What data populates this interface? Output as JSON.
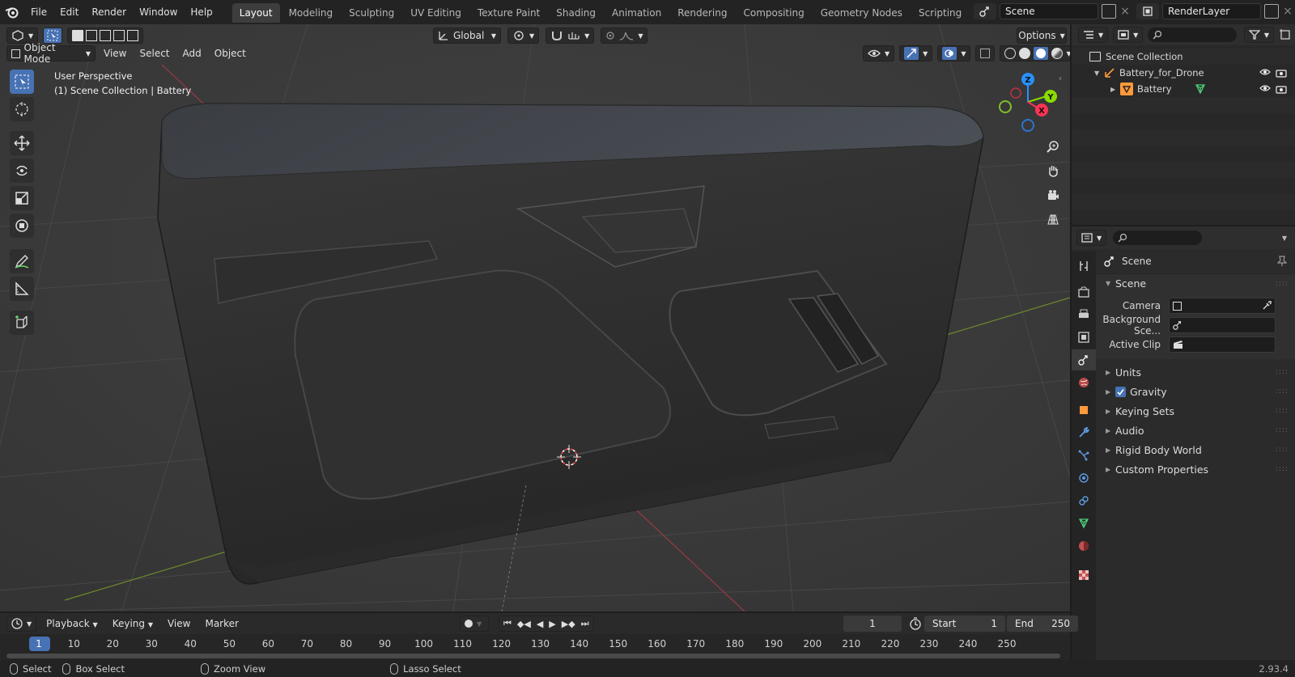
{
  "menu": {
    "items": [
      "File",
      "Edit",
      "Render",
      "Window",
      "Help"
    ]
  },
  "workspaces": {
    "tabs": [
      "Layout",
      "Modeling",
      "Sculpting",
      "UV Editing",
      "Texture Paint",
      "Shading",
      "Animation",
      "Rendering",
      "Compositing",
      "Geometry Nodes",
      "Scripting"
    ],
    "active": "Layout",
    "add_label": "+"
  },
  "scene_selector": {
    "value": "Scene"
  },
  "view_layer_selector": {
    "value": "RenderLayer"
  },
  "viewport": {
    "transform_orientation": "Global",
    "options_label": "Options",
    "mode": "Object Mode",
    "header_menus": [
      "View",
      "Select",
      "Add",
      "Object"
    ],
    "overlay_text": {
      "perspective": "User Perspective",
      "collection": "(1) Scene Collection | Battery"
    },
    "gizmo_axes": {
      "z": "Z",
      "y": "Y",
      "x": "X"
    }
  },
  "outliner": {
    "search_placeholder": "",
    "rows": [
      {
        "label": "Scene Collection"
      },
      {
        "label": "Battery_for_Drone"
      },
      {
        "label": "Battery"
      }
    ]
  },
  "properties": {
    "search_placeholder": "",
    "context_label": "Scene",
    "scene_panel": {
      "title": "Scene",
      "fields": [
        {
          "label": "Camera",
          "value": ""
        },
        {
          "label": "Background Sce...",
          "value": ""
        },
        {
          "label": "Active Clip",
          "value": ""
        }
      ]
    },
    "panels": [
      {
        "label": "Units",
        "checkbox": false
      },
      {
        "label": "Gravity",
        "checkbox": true
      },
      {
        "label": "Keying Sets",
        "checkbox": false
      },
      {
        "label": "Audio",
        "checkbox": false
      },
      {
        "label": "Rigid Body World",
        "checkbox": false
      },
      {
        "label": "Custom Properties",
        "checkbox": false
      }
    ]
  },
  "timeline": {
    "menus": [
      "Playback",
      "Keying",
      "View",
      "Marker"
    ],
    "current_frame": "1",
    "start_label": "Start",
    "start_value": "1",
    "end_label": "End",
    "end_value": "250",
    "ruler_labels": [
      "1",
      "10",
      "20",
      "30",
      "40",
      "50",
      "60",
      "70",
      "80",
      "90",
      "100",
      "110",
      "120",
      "130",
      "140",
      "150",
      "160",
      "170",
      "180",
      "190",
      "200",
      "210",
      "220",
      "230",
      "240",
      "250"
    ]
  },
  "statusbar": {
    "hints": [
      "Select",
      "Box Select",
      "Zoom View",
      "Lasso Select"
    ],
    "version": "2.93.4"
  },
  "colors": {
    "accent_blue": "#4772b3",
    "axis_x": "#ff3352",
    "axis_y": "#8bdc00",
    "axis_z": "#2890ff",
    "object_orange": "#ff9a3c"
  }
}
